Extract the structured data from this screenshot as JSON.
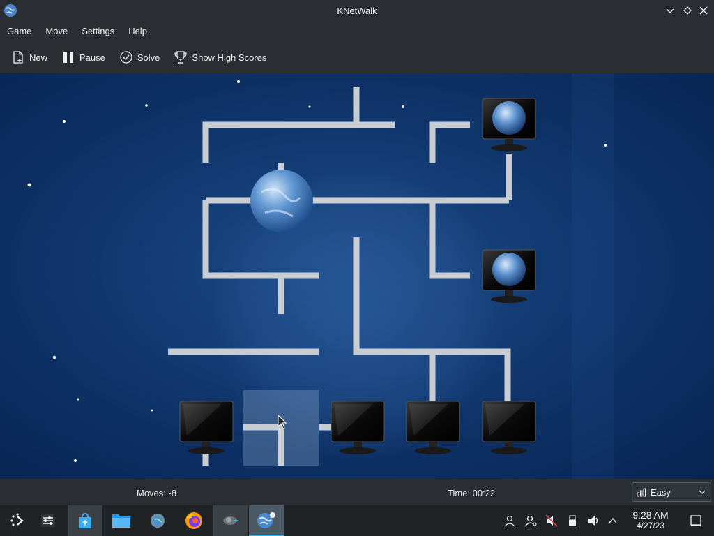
{
  "window": {
    "title": "KNetWalk"
  },
  "menu": {
    "items": [
      "Game",
      "Move",
      "Settings",
      "Help"
    ]
  },
  "toolbar": {
    "new": "New",
    "pause": "Pause",
    "solve": "Solve",
    "highscores": "Show High Scores"
  },
  "status": {
    "moves": "Moves: -8",
    "time": "Time: 00:22",
    "difficulty": "Easy"
  },
  "taskbar": {
    "time": "9:28 AM",
    "date": "4/27/23"
  },
  "colors": {
    "accent": "#3daee9",
    "board": "#123a72",
    "pipe": "#c9cfd4",
    "panel": "#2a2e32"
  },
  "icons": {
    "app": "globe-icon",
    "new": "new-document-icon",
    "pause": "pause-icon",
    "solve": "checkmark-circle-icon",
    "highscores": "trophy-icon"
  }
}
